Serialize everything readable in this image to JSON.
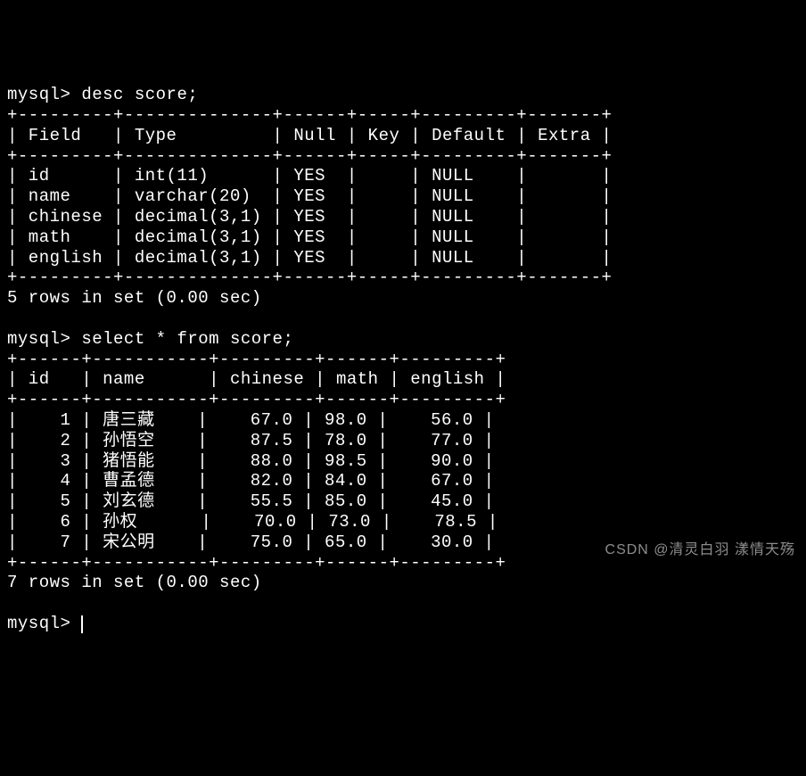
{
  "prompt": "mysql>",
  "cmd1": "desc score;",
  "cmd2": "select * from score;",
  "desc_table": {
    "border_top": "+---------+--------------+------+-----+---------+-------+",
    "header": "| Field   | Type         | Null | Key | Default | Extra |",
    "border_mid": "+---------+--------------+------+-----+---------+-------+",
    "rows": [
      "| id      | int(11)      | YES  |     | NULL    |       |",
      "| name    | varchar(20)  | YES  |     | NULL    |       |",
      "| chinese | decimal(3,1) | YES  |     | NULL    |       |",
      "| math    | decimal(3,1) | YES  |     | NULL    |       |",
      "| english | decimal(3,1) | YES  |     | NULL    |       |"
    ],
    "border_bot": "+---------+--------------+------+-----+---------+-------+",
    "summary": "5 rows in set (0.00 sec)"
  },
  "select_table": {
    "border_top": "+------+-----------+---------+------+---------+",
    "header": "| id   | name      | chinese | math | english |",
    "border_mid": "+------+-----------+---------+------+---------+",
    "rows": [
      "|    1 | 唐三藏    |    67.0 | 98.0 |    56.0 |",
      "|    2 | 孙悟空    |    87.5 | 78.0 |    77.0 |",
      "|    3 | 猪悟能    |    88.0 | 98.5 |    90.0 |",
      "|    4 | 曹孟德    |    82.0 | 84.0 |    67.0 |",
      "|    5 | 刘玄德    |    55.5 | 85.0 |    45.0 |",
      "|    6 | 孙权      |    70.0 | 73.0 |    78.5 |",
      "|    7 | 宋公明    |    75.0 | 65.0 |    30.0 |"
    ],
    "border_bot": "+------+-----------+---------+------+---------+",
    "summary": "7 rows in set (0.00 sec)"
  },
  "chart_data": [
    {
      "type": "table",
      "title": "desc score",
      "columns": [
        "Field",
        "Type",
        "Null",
        "Key",
        "Default",
        "Extra"
      ],
      "rows": [
        [
          "id",
          "int(11)",
          "YES",
          "",
          "NULL",
          ""
        ],
        [
          "name",
          "varchar(20)",
          "YES",
          "",
          "NULL",
          ""
        ],
        [
          "chinese",
          "decimal(3,1)",
          "YES",
          "",
          "NULL",
          ""
        ],
        [
          "math",
          "decimal(3,1)",
          "YES",
          "",
          "NULL",
          ""
        ],
        [
          "english",
          "decimal(3,1)",
          "YES",
          "",
          "NULL",
          ""
        ]
      ]
    },
    {
      "type": "table",
      "title": "select * from score",
      "columns": [
        "id",
        "name",
        "chinese",
        "math",
        "english"
      ],
      "rows": [
        [
          1,
          "唐三藏",
          67.0,
          98.0,
          56.0
        ],
        [
          2,
          "孙悟空",
          87.5,
          78.0,
          77.0
        ],
        [
          3,
          "猪悟能",
          88.0,
          98.5,
          90.0
        ],
        [
          4,
          "曹孟德",
          82.0,
          84.0,
          67.0
        ],
        [
          5,
          "刘玄德",
          55.5,
          85.0,
          45.0
        ],
        [
          6,
          "孙权",
          70.0,
          73.0,
          78.5
        ],
        [
          7,
          "宋公明",
          75.0,
          65.0,
          30.0
        ]
      ]
    }
  ],
  "watermark": "CSDN @清灵白羽 漾情天殇"
}
